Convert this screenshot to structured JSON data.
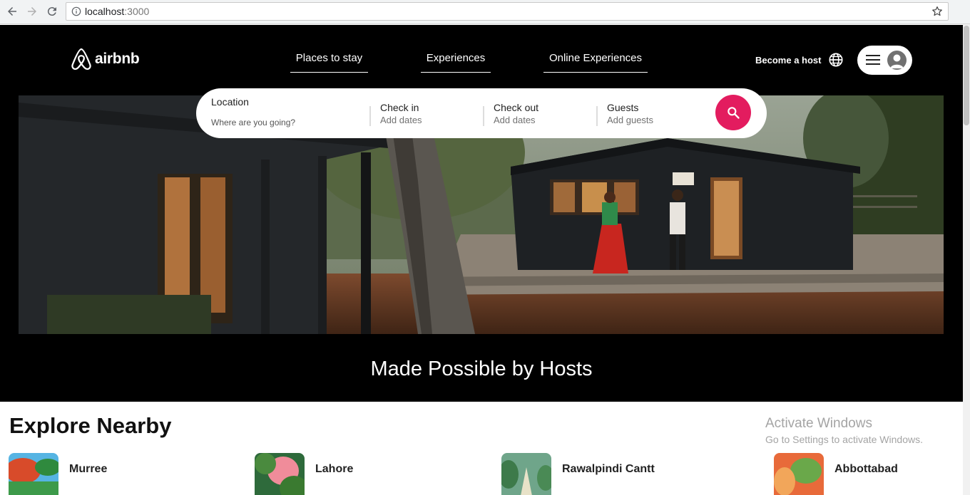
{
  "browser": {
    "url_host": "localhost",
    "url_port": ":3000"
  },
  "header": {
    "brand": "airbnb",
    "nav": [
      {
        "label": "Places to stay"
      },
      {
        "label": "Experiences"
      },
      {
        "label": "Online Experiences"
      }
    ],
    "become_host": "Become a host"
  },
  "search": {
    "location_label": "Location",
    "location_placeholder": "Where are you going?",
    "checkin_label": "Check in",
    "checkin_value": "Add dates",
    "checkout_label": "Check out",
    "checkout_value": "Add dates",
    "guests_label": "Guests",
    "guests_value": "Add guests"
  },
  "hero": {
    "tagline": "Made Possible by Hosts"
  },
  "explore": {
    "title": "Explore Nearby",
    "places": [
      {
        "name": "Murree"
      },
      {
        "name": "Lahore"
      },
      {
        "name": "Rawalpindi Cantt"
      },
      {
        "name": "Abbottabad"
      }
    ]
  },
  "watermark": {
    "title": "Activate Windows",
    "subtitle": "Go to Settings to activate Windows."
  },
  "colors": {
    "brand": "#e31c5f",
    "background": "#000000"
  }
}
